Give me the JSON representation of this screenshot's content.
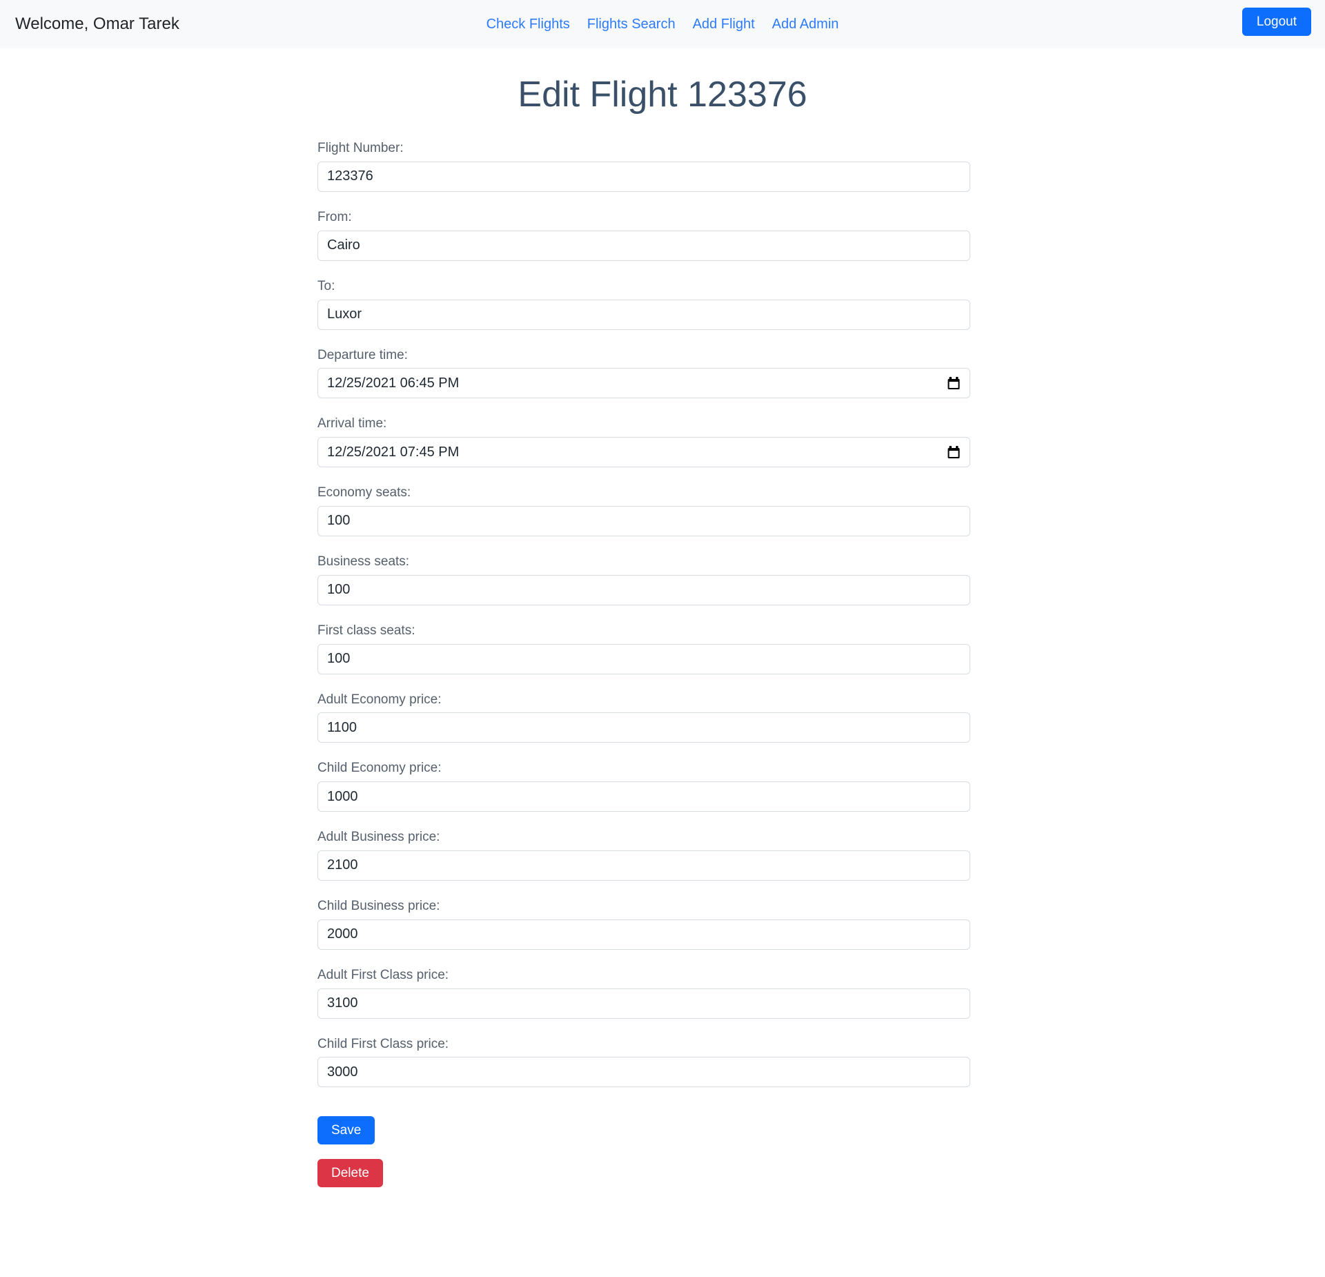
{
  "navbar": {
    "welcome": "Welcome, Omar Tarek",
    "links": [
      {
        "label": "Check Flights"
      },
      {
        "label": "Flights Search"
      },
      {
        "label": "Add Flight"
      },
      {
        "label": "Add Admin"
      }
    ],
    "logout_label": "Logout"
  },
  "page": {
    "title": "Edit Flight 123376"
  },
  "form": {
    "fields": [
      {
        "label": "Flight Number:",
        "value": "123376",
        "type": "text"
      },
      {
        "label": "From:",
        "value": "Cairo",
        "type": "text"
      },
      {
        "label": "To:",
        "value": "Luxor",
        "type": "text"
      },
      {
        "label": "Departure time:",
        "value": "12/25/2021 06:45 PM",
        "type": "datetime"
      },
      {
        "label": "Arrival time:",
        "value": "12/25/2021 07:45 PM",
        "type": "datetime"
      },
      {
        "label": "Economy seats:",
        "value": "100",
        "type": "number"
      },
      {
        "label": "Business seats:",
        "value": "100",
        "type": "number"
      },
      {
        "label": "First class seats:",
        "value": "100",
        "type": "number"
      },
      {
        "label": "Adult Economy price:",
        "value": "1100",
        "type": "number"
      },
      {
        "label": "Child Economy price:",
        "value": "1000",
        "type": "number"
      },
      {
        "label": "Adult Business price:",
        "value": "2100",
        "type": "number"
      },
      {
        "label": "Child Business price:",
        "value": "2000",
        "type": "number"
      },
      {
        "label": "Adult First Class price:",
        "value": "3100",
        "type": "number"
      },
      {
        "label": "Child First Class price:",
        "value": "3000",
        "type": "number"
      }
    ],
    "save_label": "Save",
    "delete_label": "Delete"
  },
  "icons": {
    "calendar": "calendar-picker-icon"
  },
  "colors": {
    "primary": "#0d6efd",
    "danger": "#dc3545",
    "link": "#2b7bfb",
    "navbar_bg": "#f8f9fa",
    "title": "#3a5069",
    "label": "#55606c",
    "input_border": "#d7dde3"
  }
}
